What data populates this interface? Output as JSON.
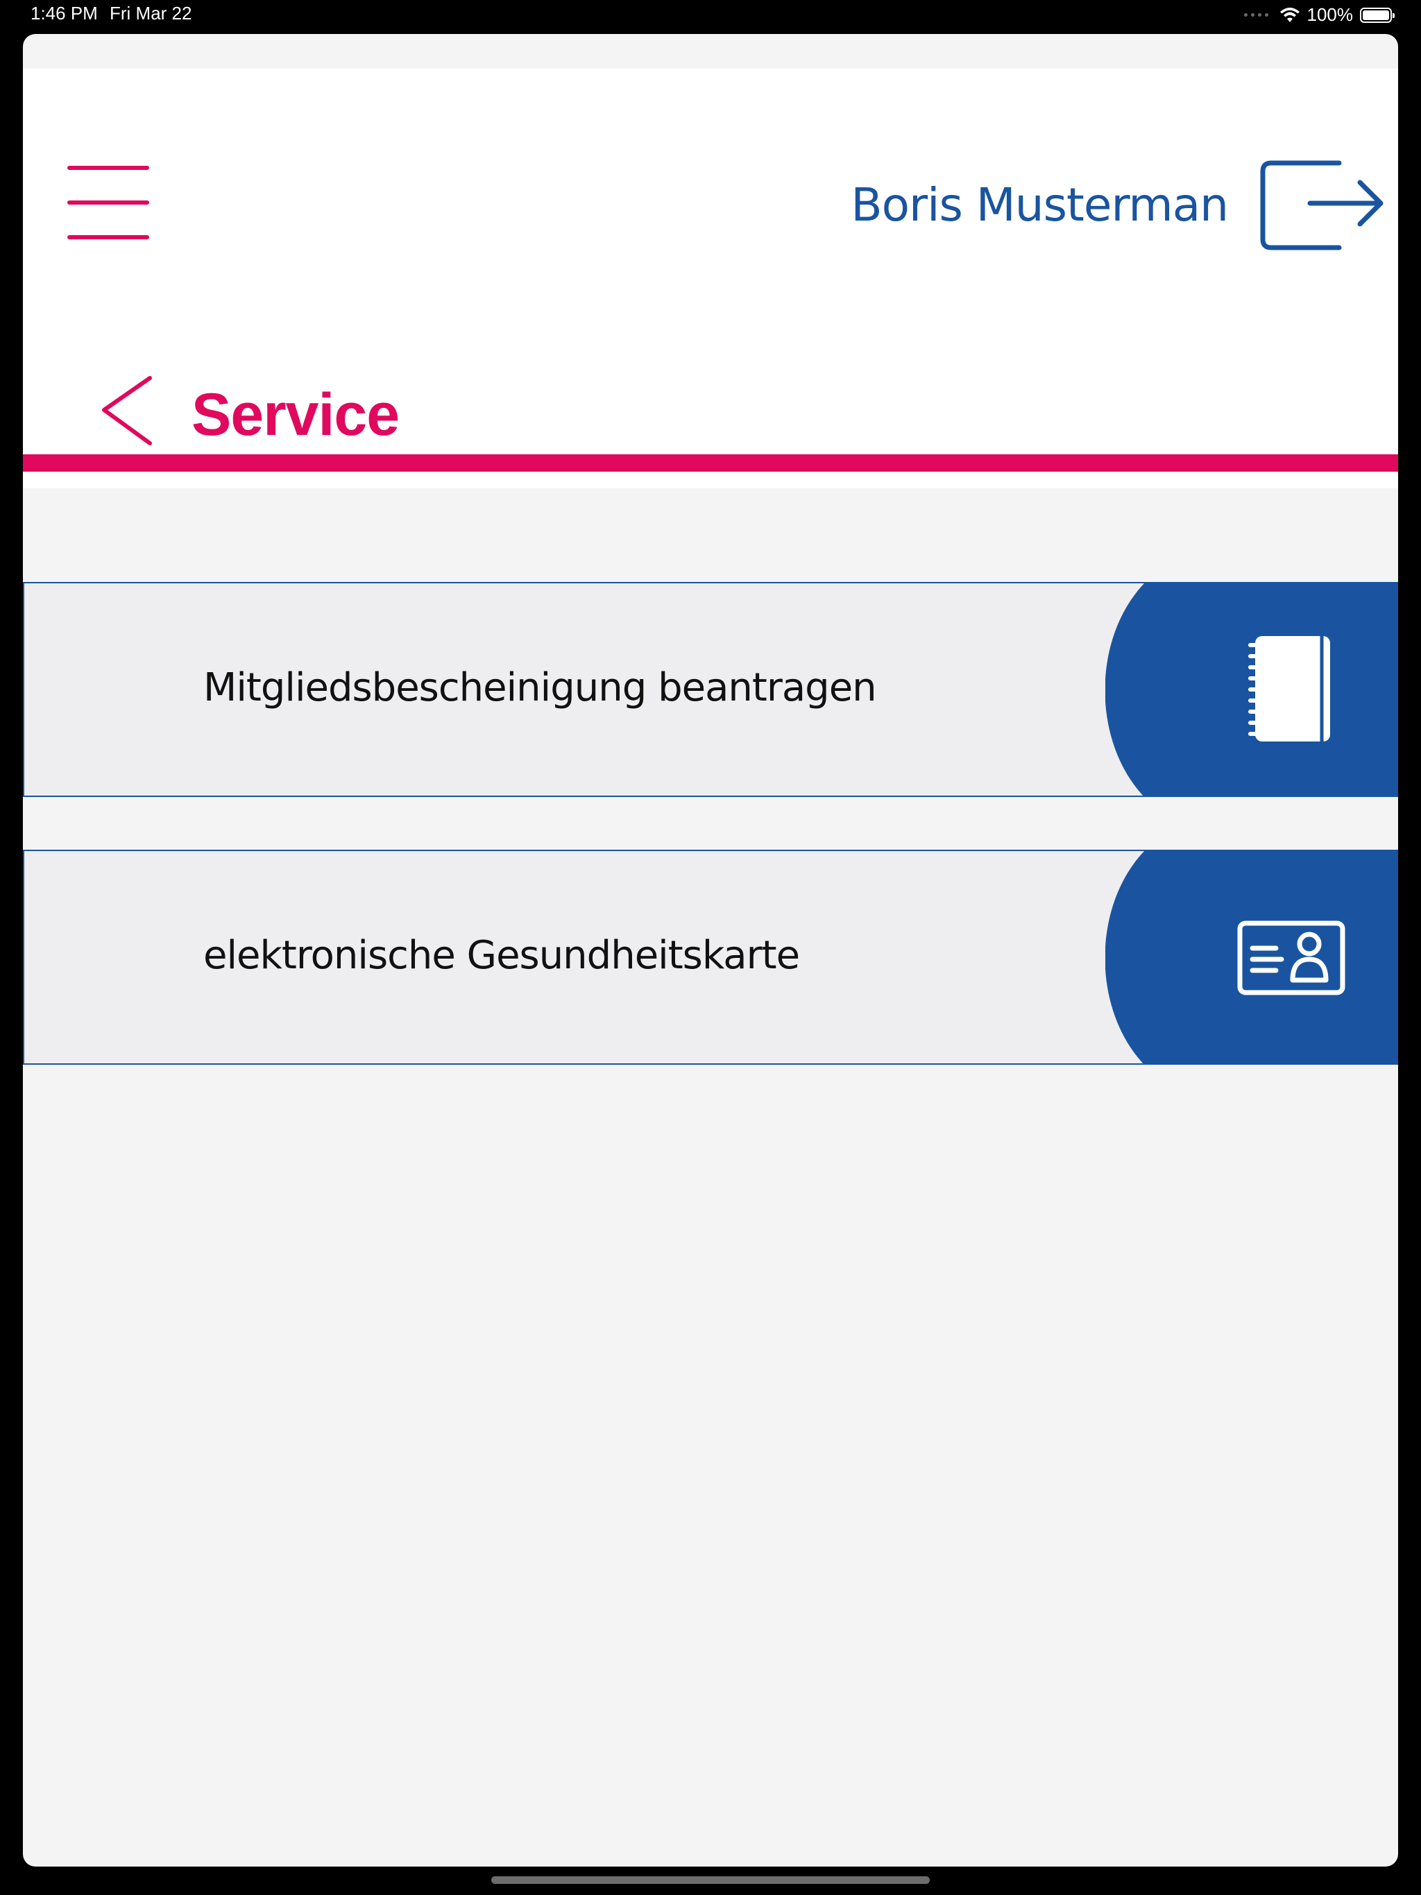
{
  "status_bar": {
    "time": "1:46 PM",
    "date": "Fri Mar 22",
    "battery": "100%"
  },
  "header": {
    "user_name": "Boris Musterman",
    "logout_icon": "logout-icon",
    "menu_icon": "hamburger-menu-icon"
  },
  "page": {
    "title": "Service",
    "back_icon": "chevron-left-icon"
  },
  "services": [
    {
      "label": "Mitgliedsbescheinigung beantragen",
      "icon": "notebook-icon"
    },
    {
      "label": "elektronische Gesundheitskarte",
      "icon": "id-card-icon"
    }
  ],
  "colors": {
    "accent": "#e0095d",
    "brand_blue": "#1a54a0",
    "row_bg": "#eeeef0",
    "page_bg": "#f4f4f4"
  }
}
